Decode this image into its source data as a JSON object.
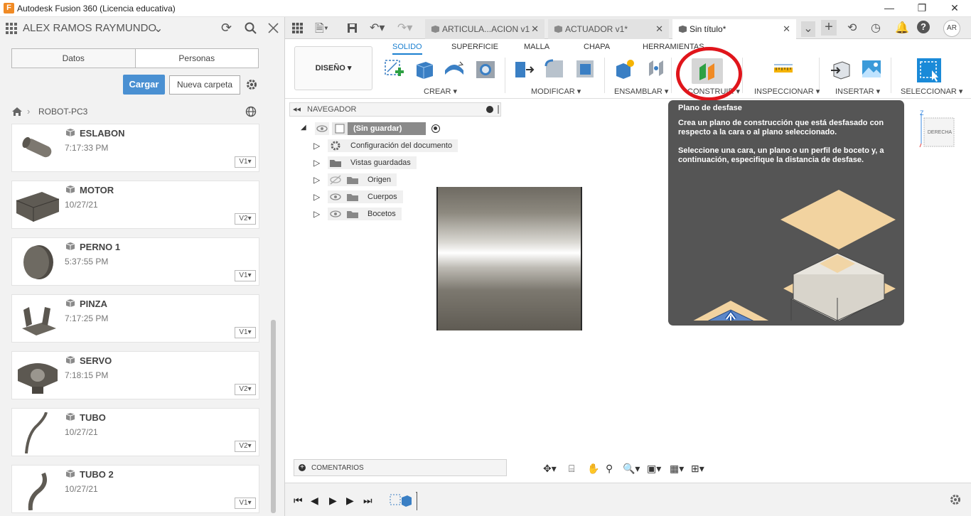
{
  "window": {
    "title": "Autodesk Fusion 360 (Licencia educativa)",
    "app_icon": "F",
    "controls": [
      "—",
      "❐",
      "✕"
    ]
  },
  "left_panel": {
    "user_name": "ALEX RAMOS RAYMUNDO",
    "toggle": [
      "Datos",
      "Personas"
    ],
    "upload_label": "Cargar",
    "new_folder_label": "Nueva carpeta",
    "breadcrumb": "ROBOT-PC3",
    "files": [
      {
        "name": "ESLABON",
        "sub": "7:17:33 PM",
        "version": "V1▾"
      },
      {
        "name": "MOTOR",
        "sub": "10/27/21",
        "version": "V2▾"
      },
      {
        "name": "PERNO 1",
        "sub": "5:37:55 PM",
        "version": "V1▾"
      },
      {
        "name": "PINZA",
        "sub": "7:17:25 PM",
        "version": "V1▾"
      },
      {
        "name": "SERVO",
        "sub": "7:18:15 PM",
        "version": "V2▾"
      },
      {
        "name": "TUBO",
        "sub": "10/27/21",
        "version": "V2▾"
      },
      {
        "name": "TUBO 2",
        "sub": "10/27/21",
        "version": "V1▾"
      }
    ]
  },
  "tabs": [
    {
      "label": "ARTICULA...ACION v1"
    },
    {
      "label": "ACTUADOR v1*"
    },
    {
      "label": "Sin título*"
    }
  ],
  "ribbon": {
    "workspace": "DISEÑO ▾",
    "tabs": [
      "SOLIDO",
      "SUPERFICIE",
      "MALLA",
      "CHAPA",
      "HERRAMIENTAS"
    ],
    "groups": [
      "CREAR ▾",
      "MODIFICAR ▾",
      "ENSAMBLAR ▾",
      "CONSTRUIR ▾",
      "INSPECCIONAR ▾",
      "INSERTAR ▾",
      "SELECCIONAR ▾"
    ]
  },
  "browser": {
    "title": "NAVEGADOR",
    "root": "(Sin guardar)",
    "items": [
      "Configuración del documento",
      "Vistas guardadas",
      "Origen",
      "Cuerpos",
      "Bocetos"
    ]
  },
  "tooltip": {
    "title": "Plano de desfase",
    "line1": "Crea un plano de construcción que está desfasado con respecto a la cara o al plano seleccionado.",
    "line2": "Seleccione una cara, un plano o un perfil de boceto y, a continuación, especifique la distancia de desfase."
  },
  "viewcube_label": "DERECHA",
  "comments_label": "COMENTARIOS",
  "user_initials": "AR",
  "colors": {
    "accent": "#1a7fd0",
    "highlight_circle": "#e0151b",
    "tooltip_bg": "#555555",
    "upload_button": "#4a90d2"
  }
}
